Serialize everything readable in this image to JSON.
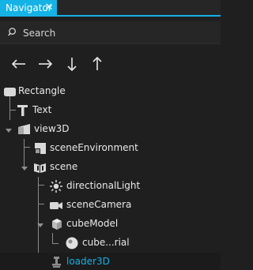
{
  "panel": {
    "tab_label": "Navigator",
    "close_glyph": "✕"
  },
  "search": {
    "placeholder": "Search",
    "value": "",
    "icon": "search-icon"
  },
  "toolbar": {
    "buttons": [
      {
        "name": "move-left-button",
        "glyph": "←"
      },
      {
        "name": "move-right-button",
        "glyph": "→"
      },
      {
        "name": "move-down-button",
        "glyph": "↓"
      },
      {
        "name": "move-up-button",
        "glyph": "↑"
      }
    ]
  },
  "tree": {
    "items": [
      {
        "label": "Rectangle",
        "icon": "rectangle-icon",
        "depth": 0,
        "expanded": null
      },
      {
        "label": "Text",
        "icon": "text-icon",
        "depth": 1,
        "expanded": null
      },
      {
        "label": "view3D",
        "icon": "view3d-icon",
        "depth": 1,
        "expanded": true
      },
      {
        "label": "sceneEnvironment",
        "icon": "scene-environment-icon",
        "depth": 2,
        "expanded": null
      },
      {
        "label": "scene",
        "icon": "scene-icon",
        "depth": 2,
        "expanded": true
      },
      {
        "label": "directionalLight",
        "icon": "directional-light-icon",
        "depth": 3,
        "expanded": null
      },
      {
        "label": "sceneCamera",
        "icon": "camera-icon",
        "depth": 3,
        "expanded": null
      },
      {
        "label": "cubeModel",
        "icon": "model-icon",
        "depth": 3,
        "expanded": true
      },
      {
        "label": "cube...rial",
        "icon": "material-icon",
        "depth": 4,
        "expanded": null
      },
      {
        "label": "loader3D",
        "icon": "loader3d-icon",
        "depth": 3,
        "expanded": null,
        "selected": true
      }
    ]
  },
  "colors": {
    "accent": "#15b2e6",
    "background": "#1f1f1f",
    "text": "#e6e6e6"
  }
}
